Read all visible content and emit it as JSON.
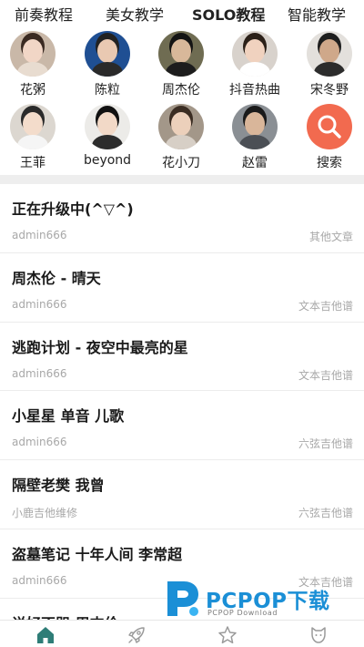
{
  "top_tabs": [
    {
      "label": "前奏教程",
      "active": false
    },
    {
      "label": "美女教学",
      "active": false
    },
    {
      "label": "SOLO教程",
      "active": true
    },
    {
      "label": "智能教学",
      "active": false
    }
  ],
  "artists": [
    {
      "name": "花粥",
      "bg": "#c9b8a8",
      "skin": "#f1d6c6",
      "hair": "#3a2a22",
      "shirt": "#e8dcd0"
    },
    {
      "name": "陈粒",
      "bg": "#1f4f93",
      "skin": "#e9c9b2",
      "hair": "#222222",
      "shirt": "#2a2a2a"
    },
    {
      "name": "周杰伦",
      "bg": "#6f6c52",
      "skin": "#d8b89a",
      "hair": "#141414",
      "shirt": "#1d1d1d"
    },
    {
      "name": "抖音热曲",
      "bg": "#d8d2cc",
      "skin": "#f0d2bf",
      "hair": "#2b2018",
      "shirt": "#ffffff"
    },
    {
      "name": "宋冬野",
      "bg": "#e3e0dc",
      "skin": "#cfa88a",
      "hair": "#1e1e1e",
      "shirt": "#2c2c2c"
    },
    {
      "name": "王菲",
      "bg": "#dcd7d0",
      "skin": "#f3dccb",
      "hair": "#2a2a2a",
      "shirt": "#f5f5f5"
    },
    {
      "name": "beyond",
      "bg": "#ecebe8",
      "skin": "#f2d9c7",
      "hair": "#111111",
      "shirt": "#2c2c2c"
    },
    {
      "name": "花小刀",
      "bg": "#a39789",
      "skin": "#ecd0bb",
      "hair": "#3b2d23",
      "shirt": "#d7cfc6"
    },
    {
      "name": "赵雷",
      "bg": "#8a8f94",
      "skin": "#d9b69a",
      "hair": "#1a1a1a",
      "shirt": "#4b4f55"
    }
  ],
  "search": {
    "label": "搜索",
    "color": "#f26a4f"
  },
  "articles": [
    {
      "title": "正在升级中(^▽^)",
      "author": "admin666",
      "category": "其他文章"
    },
    {
      "title": "周杰伦 - 晴天",
      "author": "admin666",
      "category": "文本吉他谱"
    },
    {
      "title": "逃跑计划 - 夜空中最亮的星",
      "author": "admin666",
      "category": "文本吉他谱"
    },
    {
      "title": "小星星 单音 儿歌",
      "author": "admin666",
      "category": "六弦吉他谱"
    },
    {
      "title": "隔壁老樊 我曾",
      "author": "小鹿吉他维修",
      "category": "六弦吉他谱"
    },
    {
      "title": "盗墓笔记 十年人间 李常超",
      "author": "admin666",
      "category": "文本吉他谱"
    },
    {
      "title": "说好不哭 周杰伦",
      "author": "",
      "category": ""
    }
  ],
  "watermark": {
    "text": "PCPOP下载",
    "sub": "PCPOP Download",
    "color": "#1b8fd6"
  },
  "bottom_nav": [
    {
      "icon": "home-icon",
      "active": true
    },
    {
      "icon": "rocket-icon",
      "active": false
    },
    {
      "icon": "star-icon",
      "active": false
    },
    {
      "icon": "profile-icon",
      "active": false
    }
  ],
  "colors": {
    "accent": "#2e7d77",
    "inactive_icon": "#9a9a9a"
  }
}
